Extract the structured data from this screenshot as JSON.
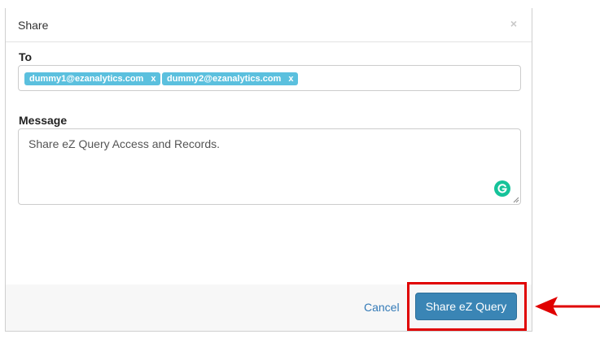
{
  "modal": {
    "title": "Share",
    "close_glyph": "×"
  },
  "to_field": {
    "label": "To",
    "tags": [
      {
        "email": "dummy1@ezanalytics.com",
        "remove_glyph": "x"
      },
      {
        "email": "dummy2@ezanalytics.com",
        "remove_glyph": "x"
      }
    ]
  },
  "message_field": {
    "label": "Message",
    "value": "Share eZ Query Access and Records."
  },
  "footer": {
    "cancel_label": "Cancel",
    "submit_label": "Share eZ Query"
  },
  "colors": {
    "tag_bg": "#5bc0de",
    "primary_button": "#3a85b5",
    "link": "#337ab7",
    "highlight": "#e00000",
    "grammarly": "#15c39a"
  },
  "icons": [
    "close-icon",
    "tag-remove-icon",
    "grammarly-icon",
    "resize-handle-icon",
    "arrow-left-icon"
  ]
}
